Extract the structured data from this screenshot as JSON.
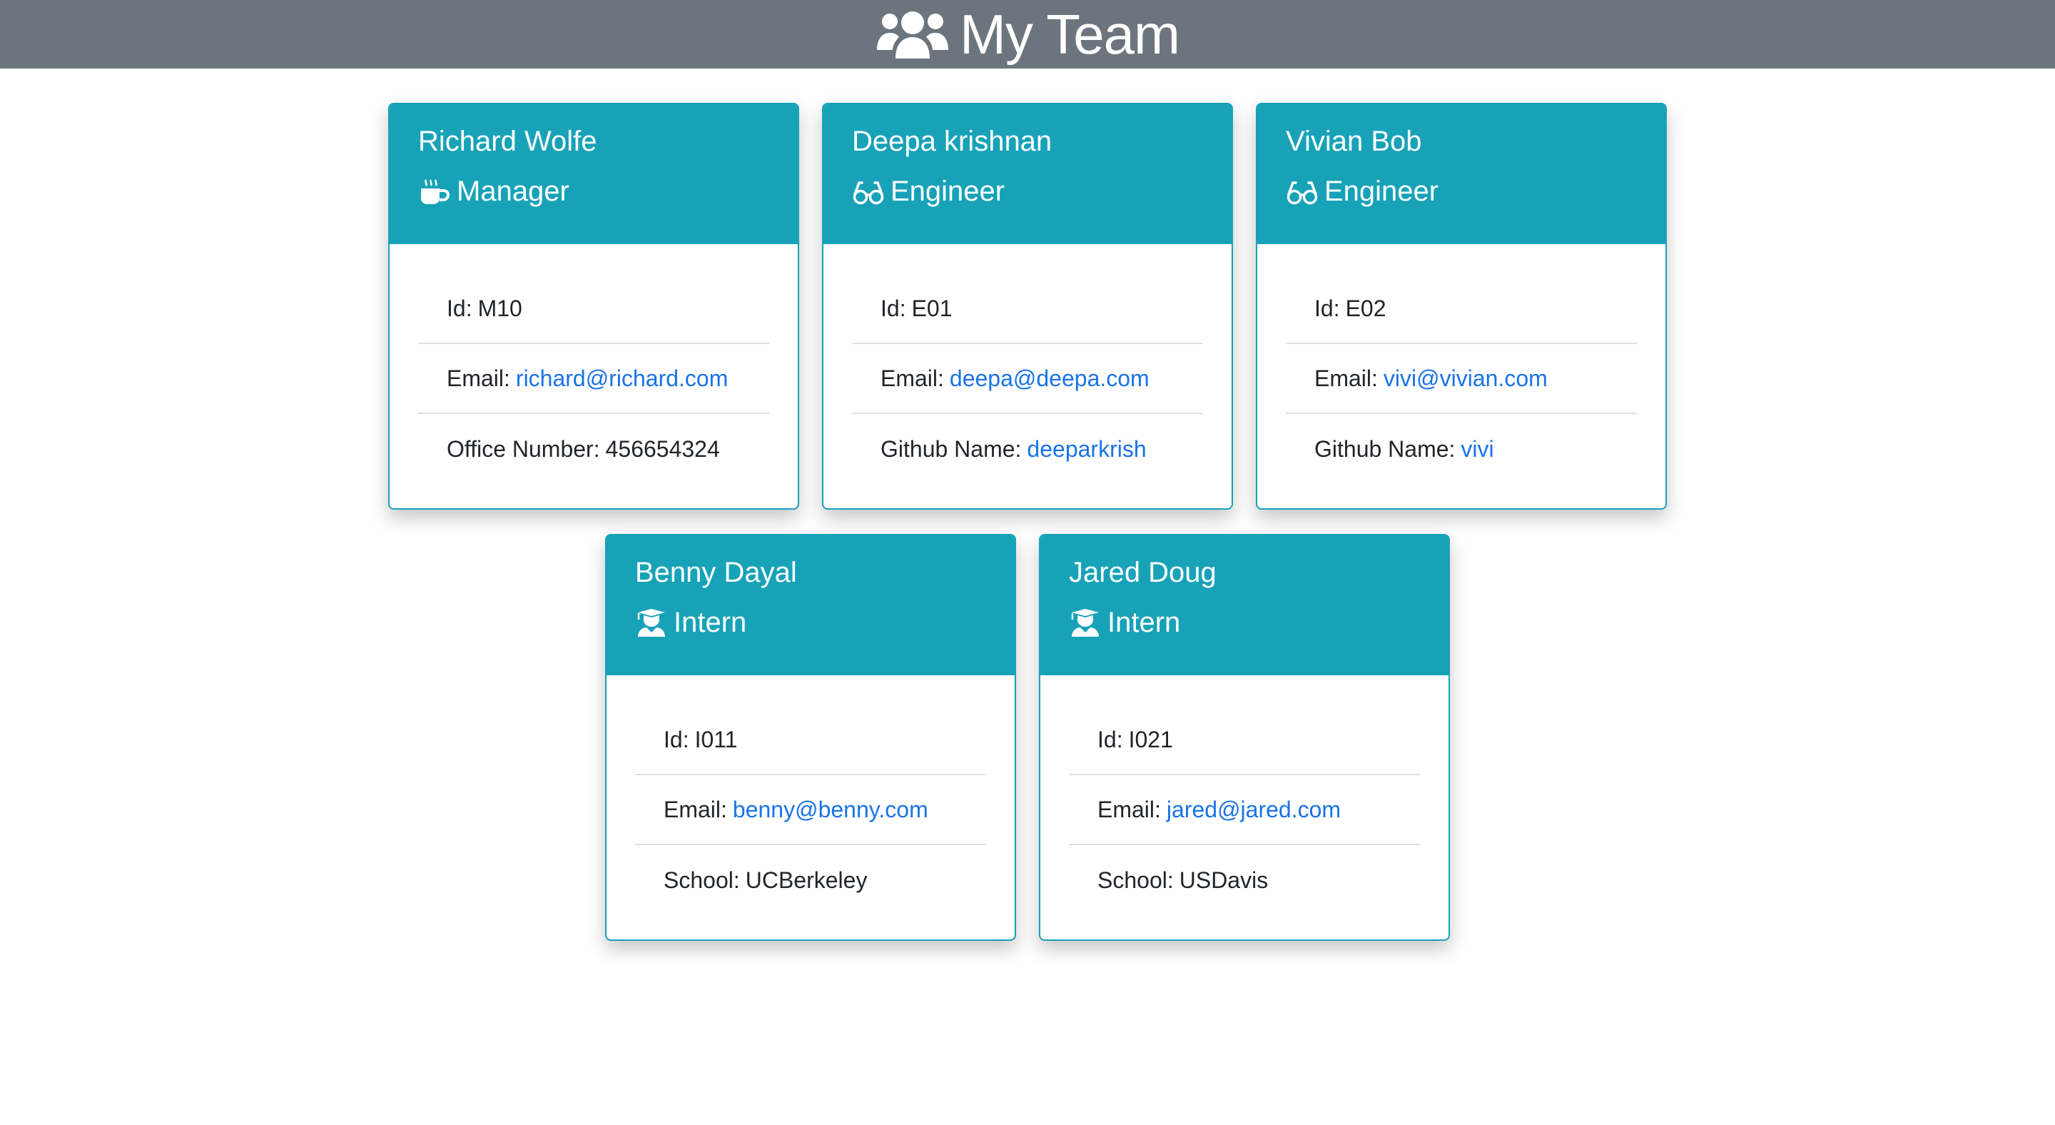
{
  "header": {
    "title": "My Team",
    "icon": "users-icon"
  },
  "colors": {
    "header_bg": "#6c757d",
    "card_accent": "#17a2b8",
    "link": "#1a73e8"
  },
  "cards": [
    {
      "name": "Richard Wolfe",
      "role": "Manager",
      "role_icon": "coffee-icon",
      "id_label": "Id:",
      "id": "M10",
      "email_label": "Email:",
      "email": "richard@richard.com",
      "extra_label": "Office Number:",
      "extra": "456654324"
    },
    {
      "name": "Deepa krishnan",
      "role": "Engineer",
      "role_icon": "glasses-icon",
      "id_label": "Id:",
      "id": "E01",
      "email_label": "Email:",
      "email": "deepa@deepa.com",
      "extra_label": "Github Name:",
      "extra": "deeparkrish"
    },
    {
      "name": "Vivian Bob",
      "role": "Engineer",
      "role_icon": "glasses-icon",
      "id_label": "Id:",
      "id": "E02",
      "email_label": "Email:",
      "email": "vivi@vivian.com",
      "extra_label": "Github Name:",
      "extra": "vivi"
    },
    {
      "name": "Benny Dayal",
      "role": "Intern",
      "role_icon": "graduate-icon",
      "id_label": "Id:",
      "id": "I011",
      "email_label": "Email:",
      "email": "benny@benny.com",
      "extra_label": "School:",
      "extra": "UCBerkeley"
    },
    {
      "name": "Jared Doug",
      "role": "Intern",
      "role_icon": "graduate-icon",
      "id_label": "Id:",
      "id": "I021",
      "email_label": "Email:",
      "email": "jared@jared.com",
      "extra_label": "School:",
      "extra": "USDavis"
    }
  ]
}
